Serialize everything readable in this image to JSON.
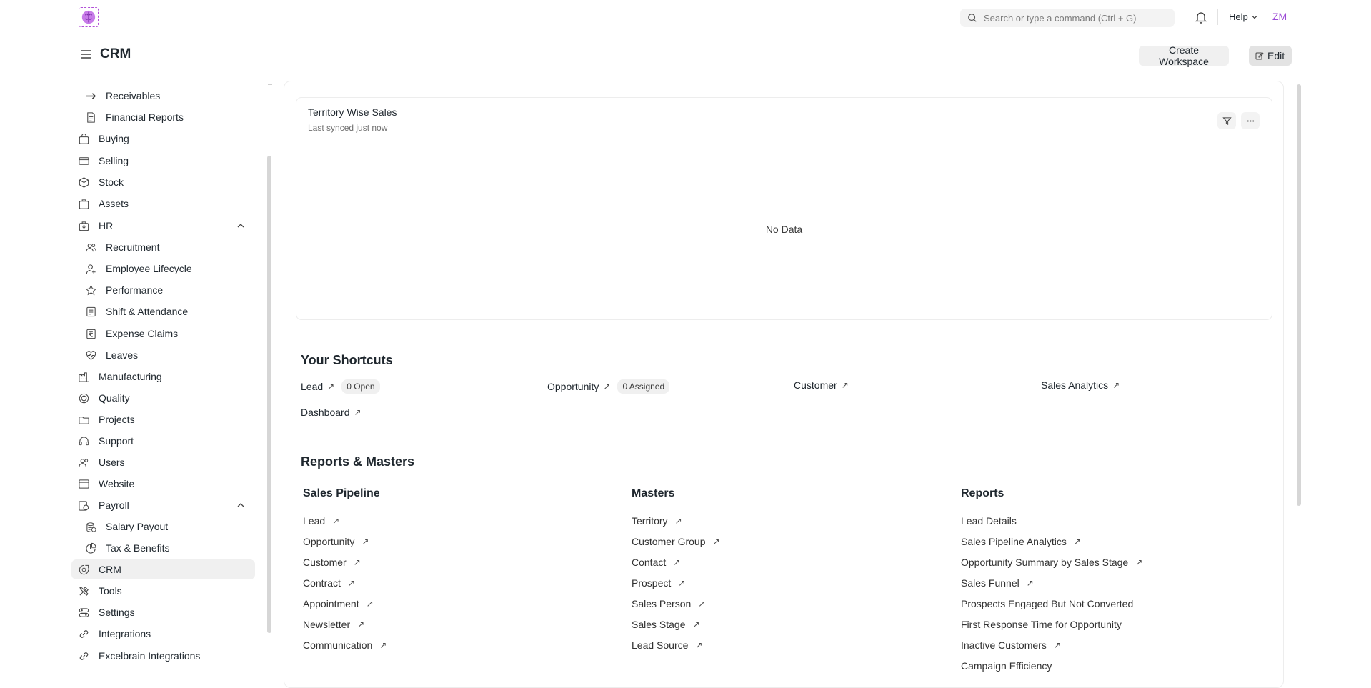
{
  "navbar": {
    "search_placeholder": "Search or type a command (Ctrl + G)",
    "help_label": "Help",
    "avatar_initials": "ZM"
  },
  "page": {
    "title": "CRM",
    "create_workspace_label": "Create Workspace",
    "edit_label": "Edit"
  },
  "sidebar": {
    "items": [
      {
        "label": "Receivables",
        "icon": "arrow-right-icon",
        "indent": true
      },
      {
        "label": "Financial Reports",
        "icon": "file-text-icon",
        "indent": true
      },
      {
        "label": "Buying",
        "icon": "shopping-bag-icon",
        "indent": false
      },
      {
        "label": "Selling",
        "icon": "card-icon",
        "indent": false
      },
      {
        "label": "Stock",
        "icon": "box-icon",
        "indent": false
      },
      {
        "label": "Assets",
        "icon": "briefcase-icon",
        "indent": false
      },
      {
        "label": "HR",
        "icon": "hr-icon",
        "indent": false,
        "expanded": true
      },
      {
        "label": "Recruitment",
        "icon": "people-icon",
        "indent": true
      },
      {
        "label": "Employee Lifecycle",
        "icon": "user-plus-icon",
        "indent": true
      },
      {
        "label": "Performance",
        "icon": "star-icon",
        "indent": true
      },
      {
        "label": "Shift & Attendance",
        "icon": "checklist-icon",
        "indent": true
      },
      {
        "label": "Expense Claims",
        "icon": "rupee-icon",
        "indent": true
      },
      {
        "label": "Leaves",
        "icon": "heart-icon",
        "indent": true
      },
      {
        "label": "Manufacturing",
        "icon": "factory-icon",
        "indent": false
      },
      {
        "label": "Quality",
        "icon": "quality-icon",
        "indent": false
      },
      {
        "label": "Projects",
        "icon": "folder-icon",
        "indent": false
      },
      {
        "label": "Support",
        "icon": "headset-icon",
        "indent": false
      },
      {
        "label": "Users",
        "icon": "users-icon",
        "indent": false
      },
      {
        "label": "Website",
        "icon": "browser-icon",
        "indent": false
      },
      {
        "label": "Payroll",
        "icon": "payroll-icon",
        "indent": false,
        "expanded": true
      },
      {
        "label": "Salary Payout",
        "icon": "coins-icon",
        "indent": true
      },
      {
        "label": "Tax & Benefits",
        "icon": "pie-icon",
        "indent": true
      },
      {
        "label": "CRM",
        "icon": "crm-icon",
        "indent": false,
        "active": true
      },
      {
        "label": "Tools",
        "icon": "tools-icon",
        "indent": false
      },
      {
        "label": "Settings",
        "icon": "settings-icon",
        "indent": false
      },
      {
        "label": "Integrations",
        "icon": "link-icon",
        "indent": false
      },
      {
        "label": "Excelbrain Integrations",
        "icon": "link-icon",
        "indent": false
      }
    ]
  },
  "chart_card": {
    "title": "Territory Wise Sales",
    "subtitle": "Last synced just now",
    "empty_text": "No Data"
  },
  "shortcuts": {
    "heading": "Your Shortcuts",
    "items": [
      {
        "label": "Lead",
        "badge": "0 Open"
      },
      {
        "label": "Opportunity",
        "badge": "0 Assigned"
      },
      {
        "label": "Customer",
        "badge": ""
      },
      {
        "label": "Sales Analytics",
        "badge": ""
      },
      {
        "label": "Dashboard",
        "badge": ""
      }
    ]
  },
  "reports": {
    "heading": "Reports & Masters",
    "cards": [
      {
        "title": "Sales Pipeline",
        "links": [
          {
            "label": "Lead",
            "arrow": true
          },
          {
            "label": "Opportunity",
            "arrow": true
          },
          {
            "label": "Customer",
            "arrow": true
          },
          {
            "label": "Contract",
            "arrow": true
          },
          {
            "label": "Appointment",
            "arrow": true
          },
          {
            "label": "Newsletter",
            "arrow": true
          },
          {
            "label": "Communication",
            "arrow": true
          }
        ]
      },
      {
        "title": "Masters",
        "links": [
          {
            "label": "Territory",
            "arrow": true
          },
          {
            "label": "Customer Group",
            "arrow": true
          },
          {
            "label": "Contact",
            "arrow": true
          },
          {
            "label": "Prospect",
            "arrow": true
          },
          {
            "label": "Sales Person",
            "arrow": true
          },
          {
            "label": "Sales Stage",
            "arrow": true
          },
          {
            "label": "Lead Source",
            "arrow": true
          }
        ]
      },
      {
        "title": "Reports",
        "links": [
          {
            "label": "Lead Details",
            "arrow": false
          },
          {
            "label": "Sales Pipeline Analytics",
            "arrow": true
          },
          {
            "label": "Opportunity Summary by Sales Stage",
            "arrow": true
          },
          {
            "label": "Sales Funnel",
            "arrow": true
          },
          {
            "label": "Prospects Engaged But Not Converted",
            "arrow": false
          },
          {
            "label": "First Response Time for Opportunity",
            "arrow": false
          },
          {
            "label": "Inactive Customers",
            "arrow": true
          },
          {
            "label": "Campaign Efficiency",
            "arrow": false
          }
        ]
      }
    ]
  },
  "colors": {
    "accent": "#9c4bd6",
    "text": "#1f272e",
    "muted": "#6f6f6f",
    "border": "#ededed",
    "pill_bg": "#f0f0f0"
  }
}
